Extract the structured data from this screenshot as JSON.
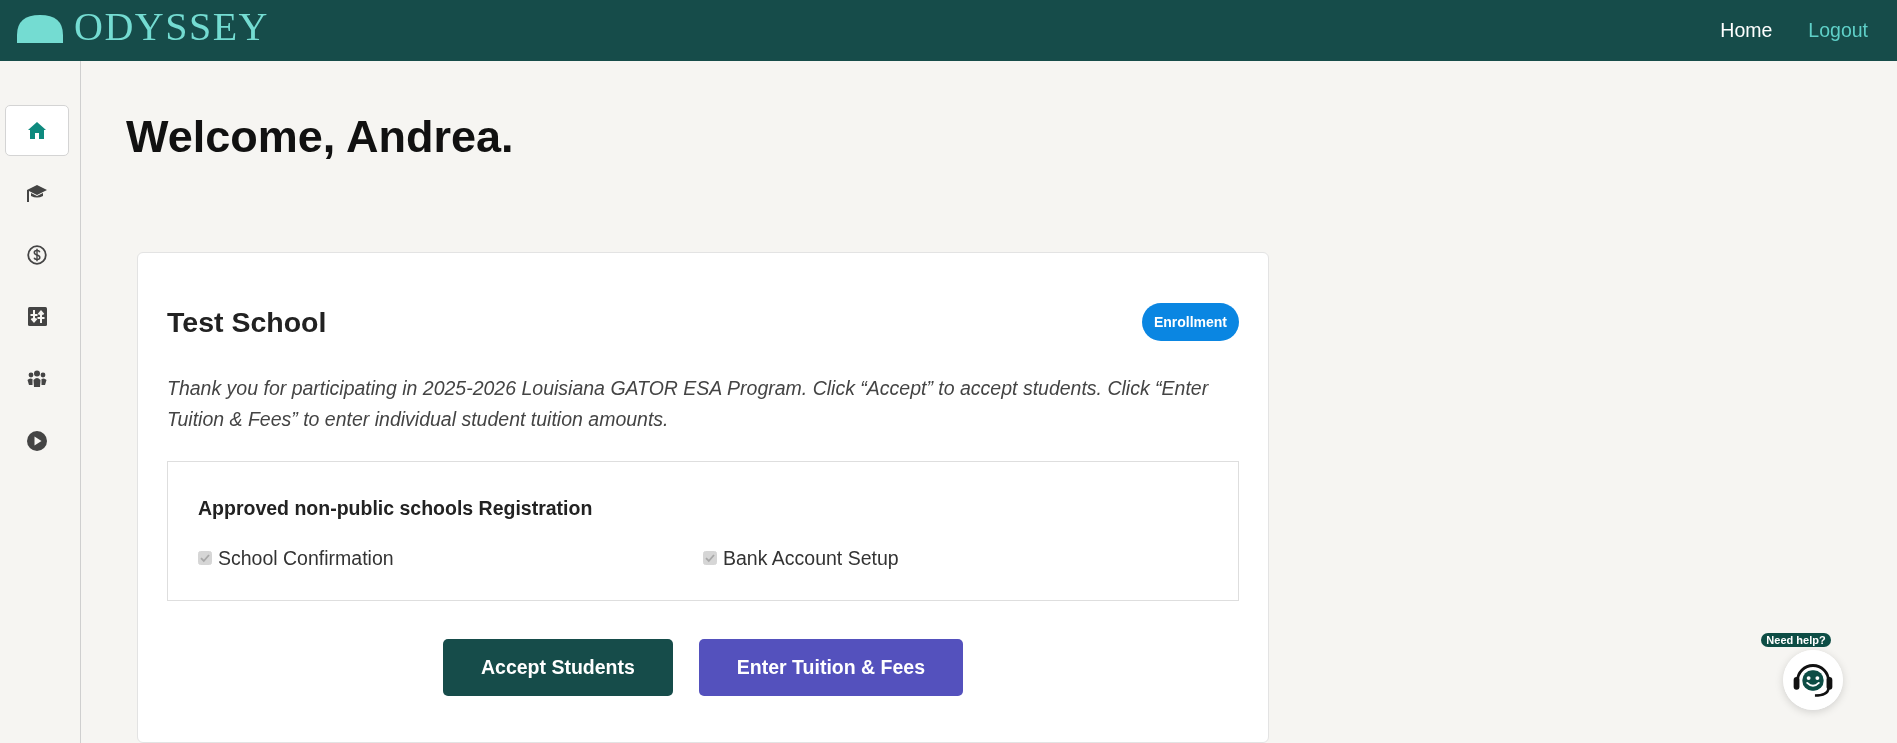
{
  "header": {
    "logo": "ODYSSEY",
    "nav": [
      {
        "label": "Home",
        "selected": true
      },
      {
        "label": "Logout",
        "selected": false
      }
    ]
  },
  "sidebar": {
    "items": [
      {
        "selected": true
      },
      {
        "selected": false
      },
      {
        "selected": false
      },
      {
        "selected": false
      },
      {
        "selected": false
      },
      {
        "selected": false
      }
    ]
  },
  "main": {
    "greeting": "Welcome, Andrea."
  },
  "card": {
    "title": "Test School",
    "badge": "Enrollment",
    "message": "Thank you for participating in 2025-2026 Louisiana GATOR ESA Program. Click “Accept” to accept students. Click “Enter Tuition & Fees” to enter individual student tuition amounts.",
    "registration": {
      "title": "Approved non-public schools Registration",
      "items": [
        {
          "label": "School Confirmation",
          "checked": true,
          "disabled": true
        },
        {
          "label": "Bank Account Setup",
          "checked": true,
          "disabled": true
        }
      ]
    },
    "buttons": [
      {
        "label": "Accept Students",
        "kind": "primary"
      },
      {
        "label": "Enter Tuition & Fees",
        "kind": "secondary"
      }
    ]
  },
  "help": {
    "label": "Need help?"
  }
}
